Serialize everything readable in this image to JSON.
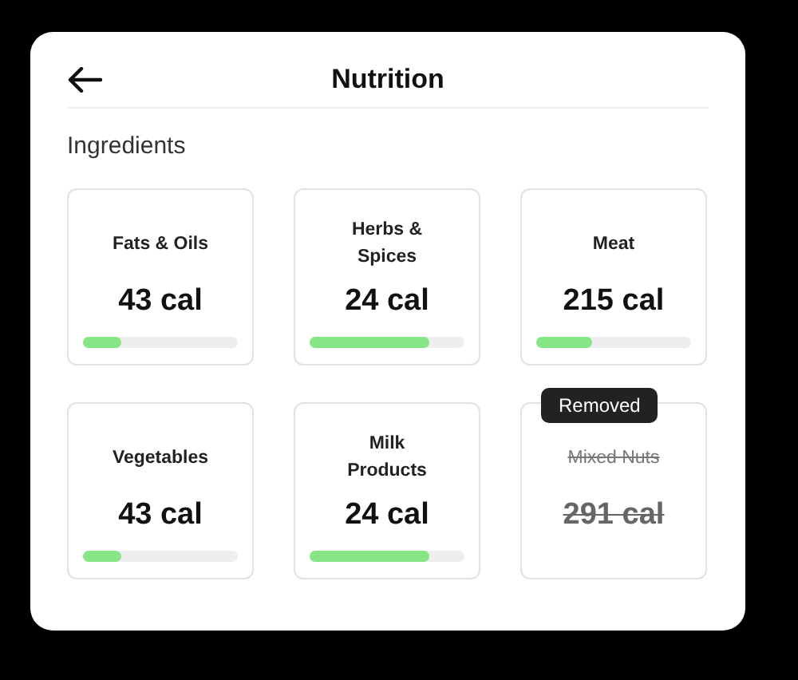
{
  "header": {
    "title": "Nutrition"
  },
  "section": {
    "title": "Ingredients"
  },
  "ingredients": [
    {
      "name": "Fats & Oils",
      "calories": "43 cal",
      "level": 0.25,
      "removed": false
    },
    {
      "name": "Herbs & Spices",
      "calories": "24 cal",
      "level": 0.77,
      "removed": false
    },
    {
      "name": "Meat",
      "calories": "215 cal",
      "level": 0.36,
      "removed": false
    },
    {
      "name": "Vegetables",
      "calories": "43 cal",
      "level": 0.25,
      "removed": false
    },
    {
      "name": "Milk Products",
      "calories": "24 cal",
      "level": 0.77,
      "removed": false
    },
    {
      "name": "Mixed Nuts",
      "calories": "291 cal",
      "removed": true,
      "badge": "Removed"
    }
  ]
}
